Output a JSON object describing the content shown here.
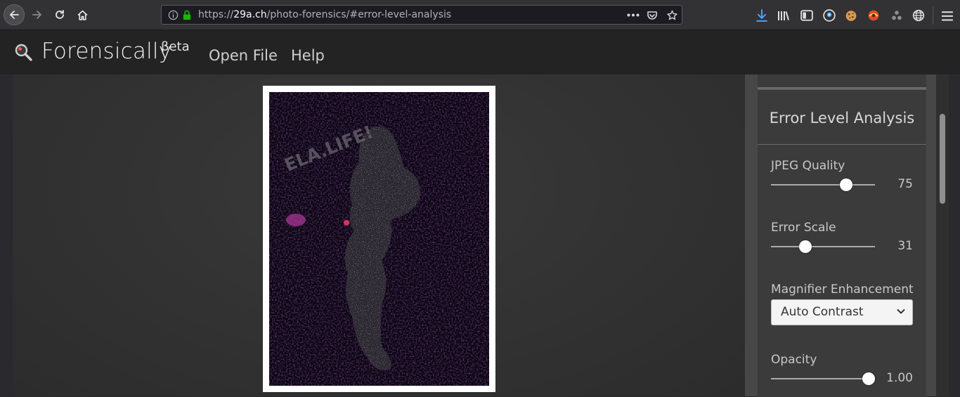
{
  "browser": {
    "url_prefix": "https://",
    "url_host": "29a.ch",
    "url_path": "/photo-forensics/#error-level-analysis"
  },
  "app": {
    "title": "Forensically",
    "beta": "βeta",
    "menu": [
      "Open File",
      "Help"
    ]
  },
  "image": {
    "watermark": "ELA.LIFE!"
  },
  "panel": {
    "title": "Error Level Analysis",
    "jpeg_quality": {
      "label": "JPEG Quality",
      "value": "75",
      "level": 0.72
    },
    "error_scale": {
      "label": "Error Scale",
      "value": "31",
      "level": 0.33
    },
    "magnifier": {
      "label": "Magnifier Enhancement",
      "selected": "Auto Contrast"
    },
    "opacity": {
      "label": "Opacity",
      "value": "1.00",
      "level": 0.94
    }
  },
  "colors": {
    "accent_download": "#45a1ff",
    "secure_lock": "#12bc00"
  },
  "icons": [
    "back-icon",
    "forward-icon",
    "reload-icon",
    "home-icon",
    "info-icon",
    "lock-icon",
    "more-icon",
    "pocket-icon",
    "star-icon",
    "download-icon",
    "library-icon",
    "sidebar-icon",
    "account-icon",
    "cookie-icon",
    "extension-icon",
    "extension-icon-2",
    "globe-icon",
    "hamburger-menu-icon",
    "magnifier-logo-icon",
    "chevron-down-icon"
  ]
}
